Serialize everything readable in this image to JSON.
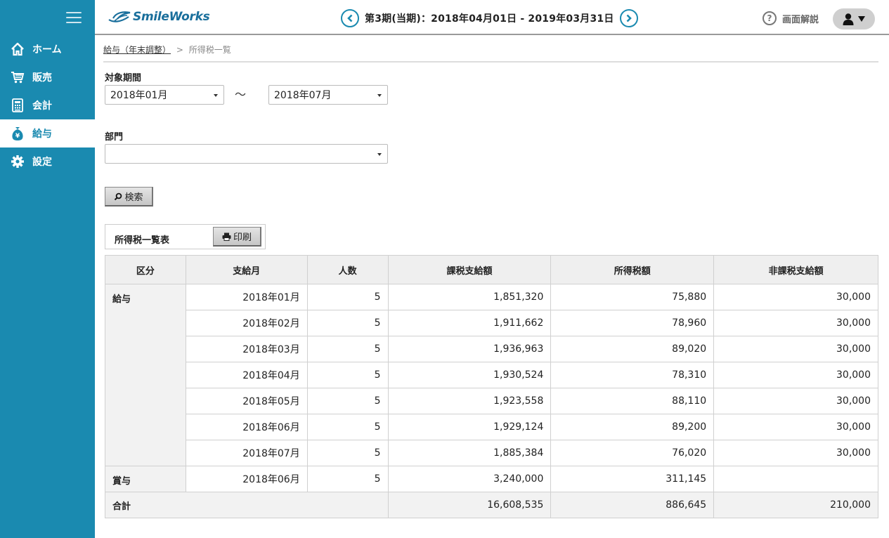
{
  "app": {
    "brand": "SmileWorks"
  },
  "header": {
    "period": "第3期(当期)：2018年04月01日 - 2019年03月31日",
    "help_label": "画面解説"
  },
  "sidebar": {
    "items": [
      {
        "label": "ホーム",
        "icon": "home-icon"
      },
      {
        "label": "販売",
        "icon": "cart-icon"
      },
      {
        "label": "会計",
        "icon": "calculator-icon"
      },
      {
        "label": "給与",
        "icon": "money-bag-icon",
        "active": true
      },
      {
        "label": "設定",
        "icon": "gear-icon"
      }
    ]
  },
  "breadcrumb": {
    "parent": "給与（年末調整）",
    "separator": ">",
    "current": "所得税一覧"
  },
  "filters": {
    "period_label": "対象期間",
    "period_from": "2018年01月",
    "period_tilde": "〜",
    "period_to": "2018年07月",
    "department_label": "部門",
    "department_value": ""
  },
  "search_label": "検索",
  "print_section": {
    "title": "所得税一覧表",
    "print_label": "印刷"
  },
  "table": {
    "headers": [
      "区分",
      "支給月",
      "人数",
      "課税支給額",
      "所得税額",
      "非課税支給額"
    ],
    "salary": {
      "category": "給与",
      "rows": [
        [
          "2018年01月",
          "5",
          "1,851,320",
          "75,880",
          "30,000"
        ],
        [
          "2018年02月",
          "5",
          "1,911,662",
          "78,960",
          "30,000"
        ],
        [
          "2018年03月",
          "5",
          "1,936,963",
          "89,020",
          "30,000"
        ],
        [
          "2018年04月",
          "5",
          "1,930,524",
          "78,310",
          "30,000"
        ],
        [
          "2018年05月",
          "5",
          "1,923,558",
          "88,110",
          "30,000"
        ],
        [
          "2018年06月",
          "5",
          "1,929,124",
          "89,200",
          "30,000"
        ],
        [
          "2018年07月",
          "5",
          "1,885,384",
          "76,020",
          "30,000"
        ]
      ]
    },
    "bonus": {
      "category": "賞与",
      "rows": [
        [
          "2018年06月",
          "5",
          "3,240,000",
          "311,145",
          ""
        ]
      ]
    },
    "total": {
      "label": "合計",
      "taxable": "16,608,535",
      "income_tax": "886,645",
      "non_taxable": "210,000"
    }
  }
}
